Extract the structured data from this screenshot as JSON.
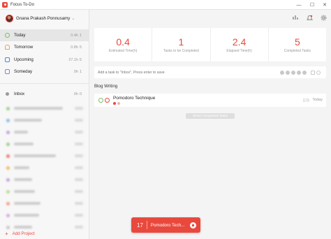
{
  "window": {
    "title": "Focus To-Do",
    "min": "—",
    "max": "☐",
    "close": "✕"
  },
  "user": {
    "name": "Gnana Prakash Ponnusamy",
    "chevron": "⌄"
  },
  "sidebar": {
    "items": [
      {
        "label": "Today",
        "time": "0.4h",
        "count": "1",
        "color": "#7cbf6a"
      },
      {
        "label": "Tomorrow",
        "time": "0.8h",
        "count": "5",
        "color": "#f0a23a"
      },
      {
        "label": "Upcoming",
        "time": "27.1h",
        "count": "5",
        "color": "#3b8ede"
      },
      {
        "label": "Someday",
        "time": "0h",
        "count": "1",
        "color": "#8f7fd6"
      }
    ],
    "inbox": {
      "label": "Inbox",
      "time": "0h",
      "count": "0",
      "color": "#999999"
    },
    "blurred_projects": [
      {
        "color": "#7cbf6a",
        "w": 70
      },
      {
        "color": "#5aa8e0",
        "w": 40
      },
      {
        "color": "#b07fd6",
        "w": 20
      },
      {
        "color": "#7cbf6a",
        "w": 28
      },
      {
        "color": "#e9493d",
        "w": 60
      },
      {
        "color": "#f0a23a",
        "w": 22
      },
      {
        "color": "#b07fd6",
        "w": 26
      },
      {
        "color": "#a0d070",
        "w": 30
      },
      {
        "color": "#f08060",
        "w": 38
      },
      {
        "color": "#c58fd8",
        "w": 36
      },
      {
        "color": "#b7b7b7",
        "w": 26
      }
    ],
    "add_project": "Add Project"
  },
  "stats": [
    {
      "value": "0.4",
      "label": "Estimated Time(h)"
    },
    {
      "value": "1",
      "label": "Tasks to be Completed"
    },
    {
      "value": "2.4",
      "label": "Elapsed Time(h)"
    },
    {
      "value": "5",
      "label": "Completed Tasks"
    }
  ],
  "add_task": {
    "placeholder": "Add a task to \"Inbox\", Press enter to save"
  },
  "section": {
    "title": "Blog Writing"
  },
  "task": {
    "name": "Pomodoro Technique",
    "date": "Today",
    "pomodoros": [
      "#e9493d",
      "#f0b5b0"
    ]
  },
  "show_completed": "Show Completed Tasks",
  "timer": {
    "value": "17",
    "task": "Pomodoro Tech..."
  },
  "colors": {
    "accent": "#e9493d"
  }
}
